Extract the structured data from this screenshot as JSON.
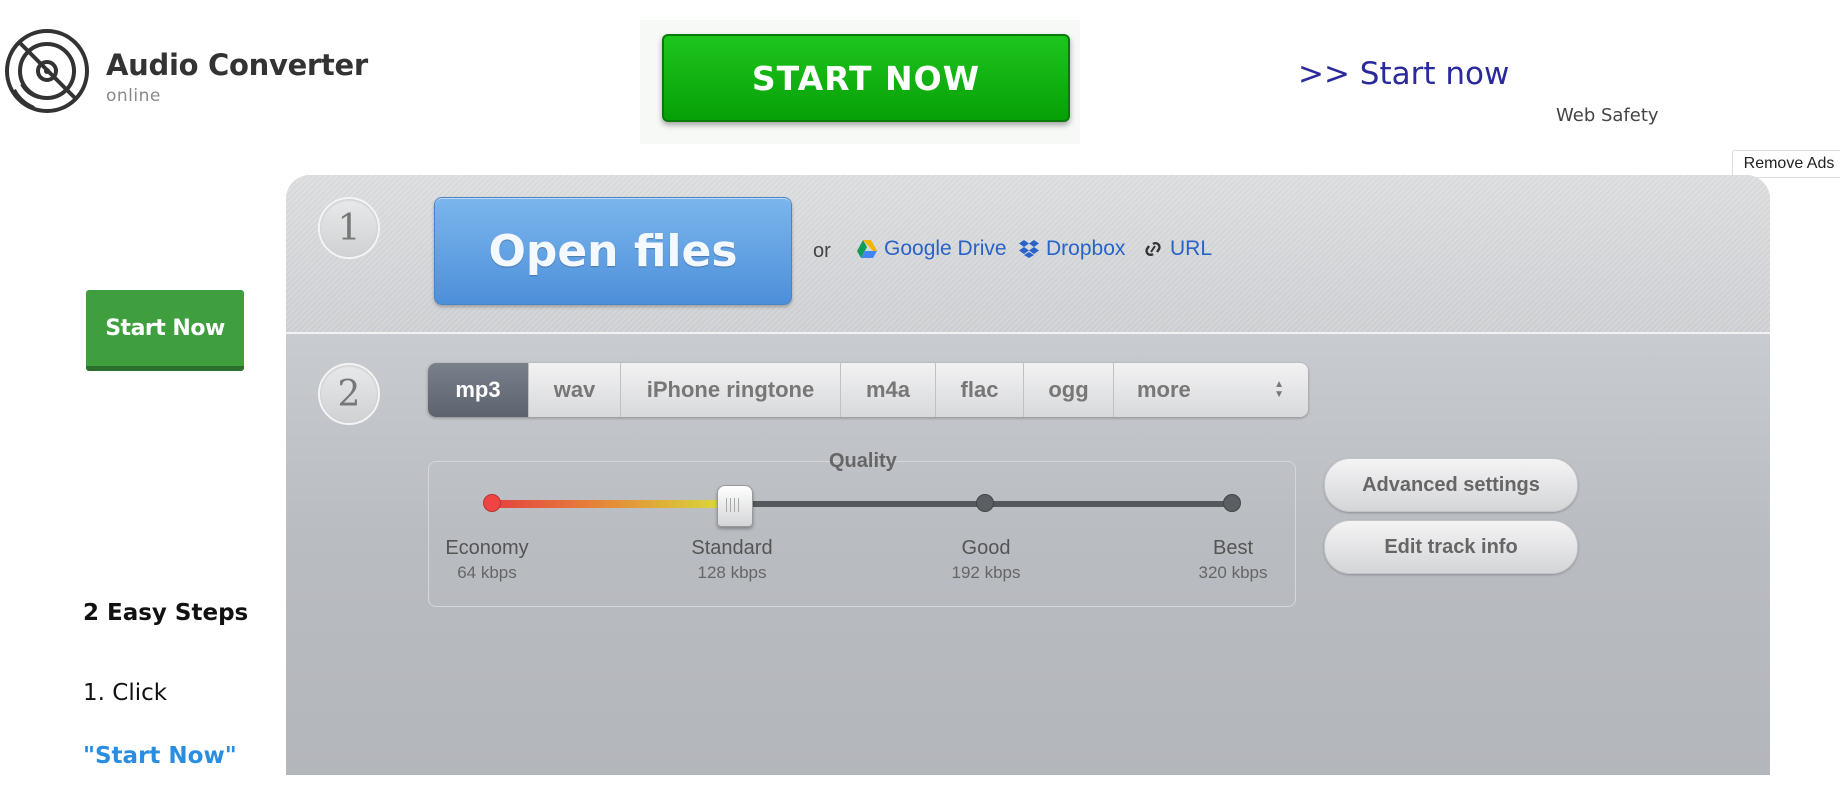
{
  "header": {
    "brand_name": "Audio Converter",
    "brand_sub": "online",
    "logo_icon": "disc-icon"
  },
  "ad": {
    "start_button": "START NOW",
    "link_text": ">> Start now",
    "web_safety": "Web Safety",
    "remove_ads": "Remove Ads",
    "button_color": "#06a006"
  },
  "sidebar": {
    "start_button": "Start Now",
    "steps_title": "2 Easy Steps",
    "step1_prefix": "1. Click ",
    "step1_link": "\"Start Now\""
  },
  "step1": {
    "number": "1",
    "open_files": "Open files",
    "or": "or",
    "sources": [
      {
        "label": "Google Drive",
        "icon": "google-drive-icon"
      },
      {
        "label": "Dropbox",
        "icon": "dropbox-icon"
      },
      {
        "label": "URL",
        "icon": "link-icon"
      }
    ]
  },
  "step2": {
    "number": "2",
    "formats": [
      "mp3",
      "wav",
      "iPhone ringtone",
      "m4a",
      "flac",
      "ogg",
      "more"
    ],
    "selected_format": "mp3",
    "quality": {
      "label": "Quality",
      "levels": [
        {
          "name": "Economy",
          "rate": "64 kbps"
        },
        {
          "name": "Standard",
          "rate": "128 kbps"
        },
        {
          "name": "Good",
          "rate": "192 kbps"
        },
        {
          "name": "Best",
          "rate": "320 kbps"
        }
      ],
      "selected": "Standard"
    },
    "advanced_settings": "Advanced settings",
    "edit_track_info": "Edit track info"
  }
}
